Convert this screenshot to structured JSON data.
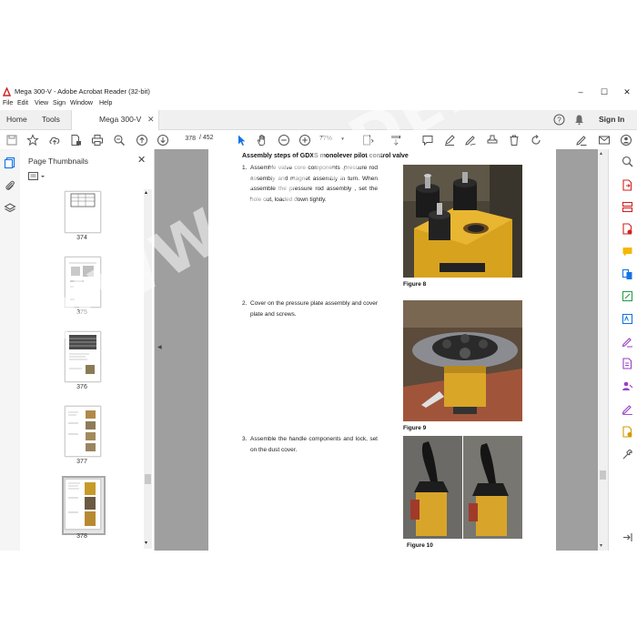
{
  "window": {
    "title": "Mega 300-V - Adobe Acrobat Reader (32-bit)"
  },
  "menu": [
    "File",
    "Edit",
    "View",
    "Sign",
    "Window",
    "Help"
  ],
  "tabs": {
    "home": "Home",
    "tools": "Tools",
    "document": "Mega 300-V",
    "sign_in": "Sign In"
  },
  "toolbar": {
    "current_page": "378",
    "total_pages": "/ 452",
    "zoom": "77%"
  },
  "thumbnails": {
    "title": "Page Thumbnails",
    "pages": [
      "374",
      "375",
      "376",
      "377",
      "378"
    ]
  },
  "document": {
    "heading": "Assembly steps of GDXS monolever pilot control valve",
    "steps": [
      {
        "num": "1.",
        "text": "Assemble valve core components ,pressure rod assembly and magnet assembly in turn. When assemble the pressure rod assembly , set the hole out, loaded down tightly."
      },
      {
        "num": "2.",
        "text": "Cover on the pressure plate assembly and cover plate and screws."
      },
      {
        "num": "3.",
        "text": "Assemble the   handle components and lock, set on the dust cover."
      }
    ],
    "figures": [
      "Figure 8",
      "Figure 9",
      "Figure 10"
    ]
  },
  "watermark": "WWW.EPCDEB.COM",
  "colors": {
    "acrobat_red": "#d2201f",
    "tool_blue": "#1473e6",
    "accent_purple": "#9a3fc2",
    "accent_green": "#2d9d4a"
  }
}
